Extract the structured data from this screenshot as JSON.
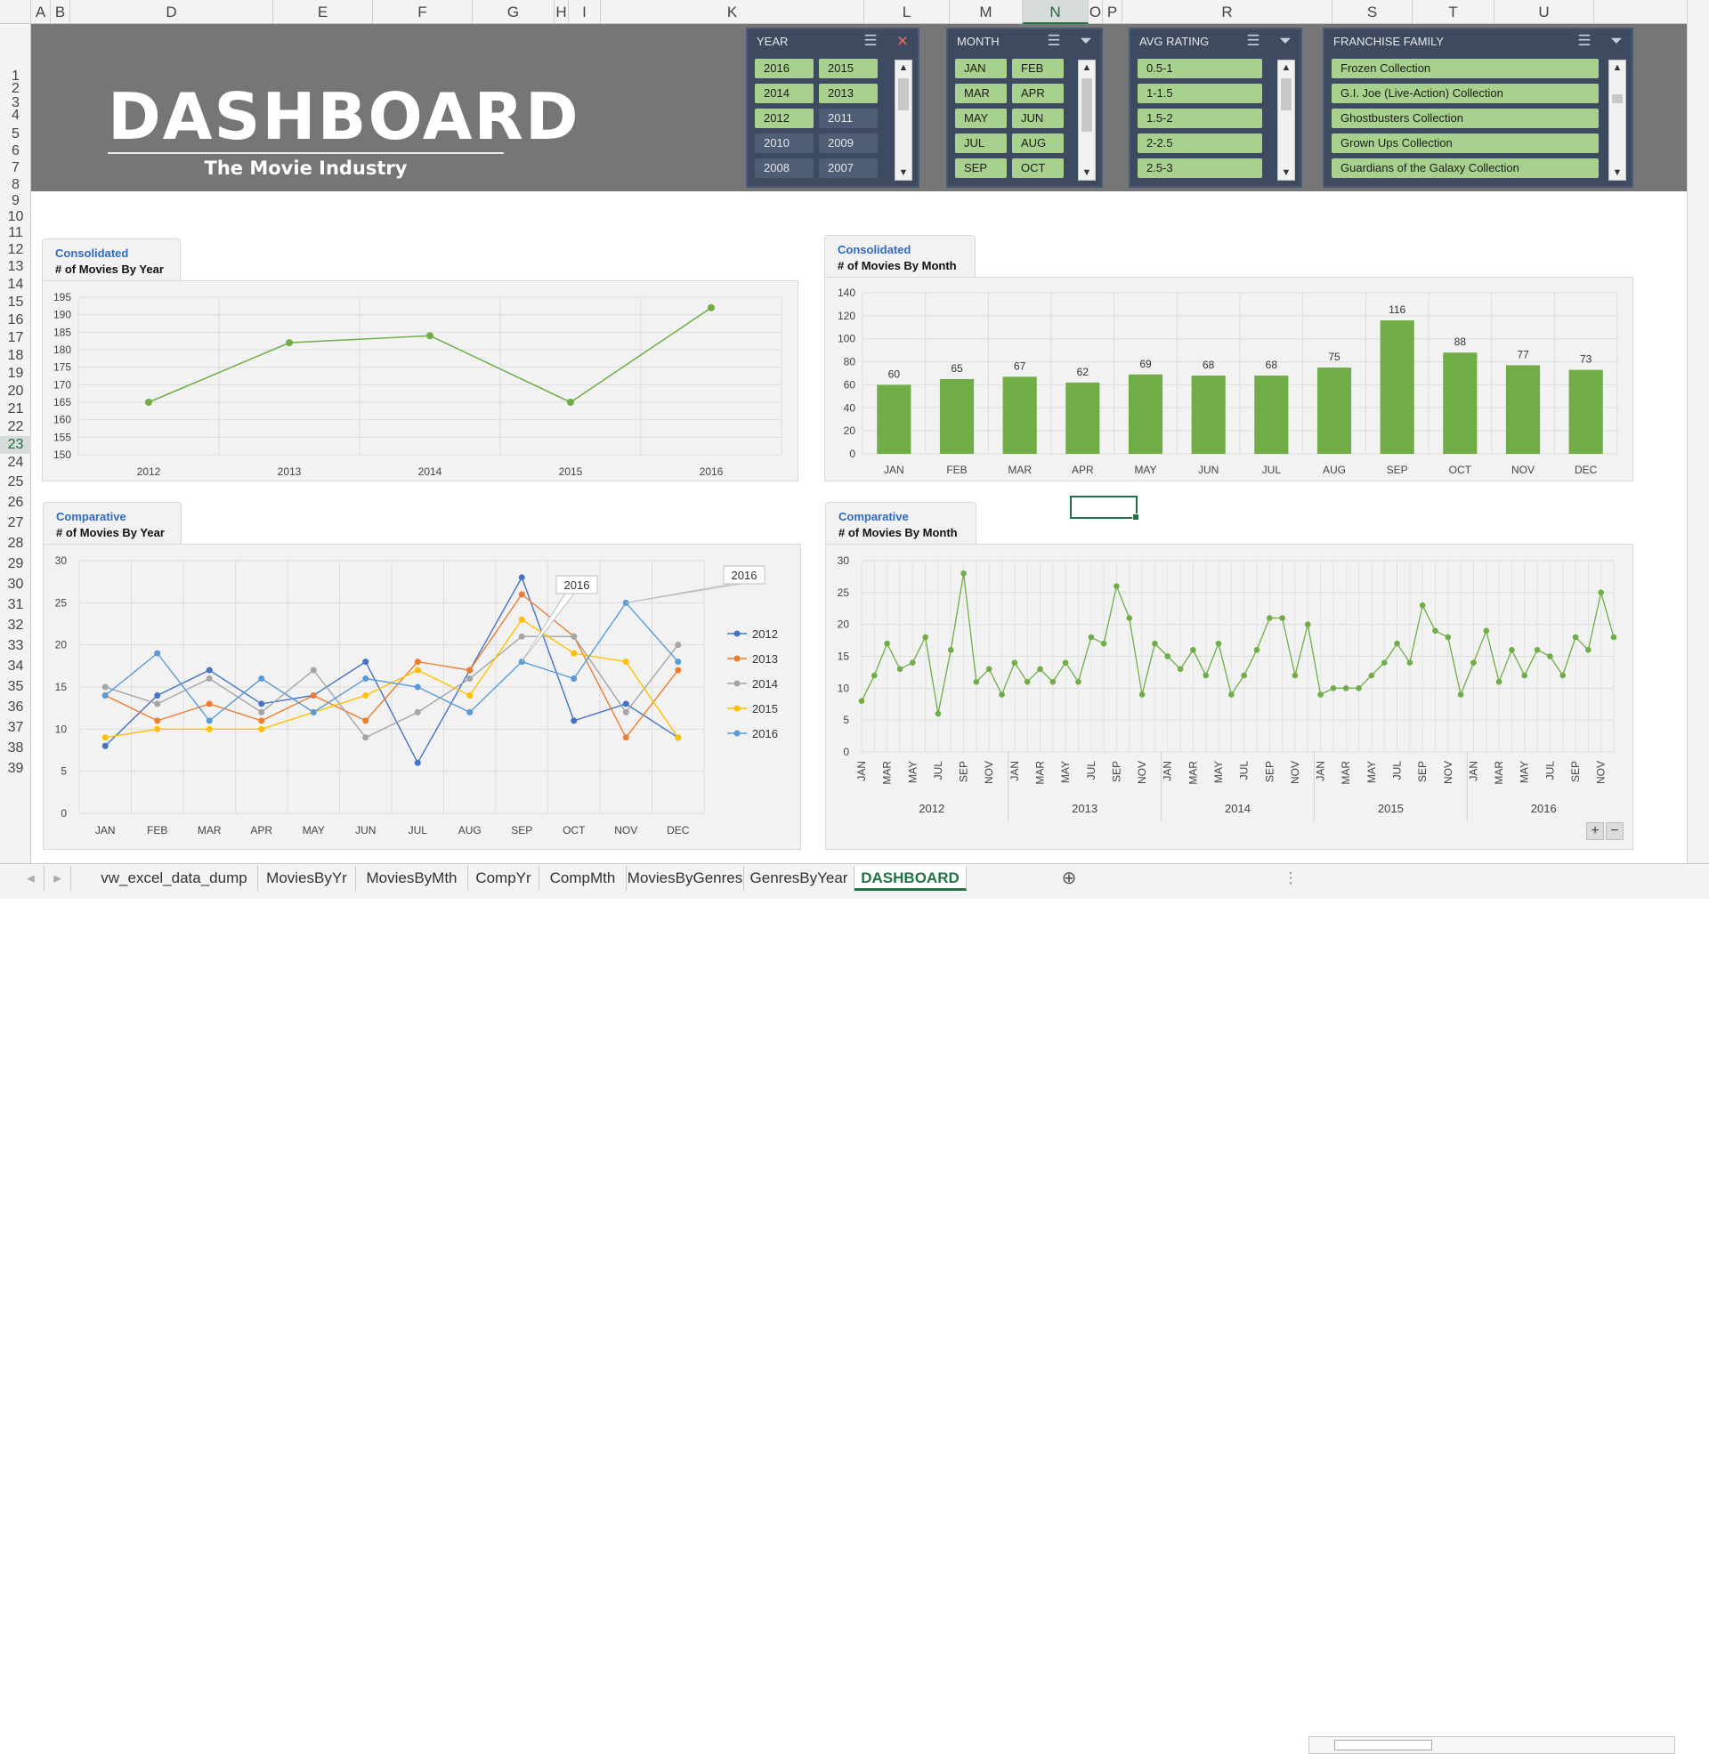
{
  "columns": [
    "A",
    "B",
    "D",
    "E",
    "F",
    "G",
    "H",
    "I",
    "K",
    "L",
    "M",
    "N",
    "O",
    "P",
    "R",
    "S",
    "T",
    "U"
  ],
  "selected_column": "N",
  "rows": [
    "1",
    "2",
    "3",
    "4",
    "5",
    "6",
    "7",
    "8",
    "9",
    "10",
    "11",
    "12",
    "13",
    "14",
    "15",
    "16",
    "17",
    "18",
    "19",
    "20",
    "21",
    "22",
    "23",
    "24",
    "25",
    "26",
    "27",
    "28",
    "29",
    "30",
    "31",
    "32",
    "33",
    "34",
    "35",
    "36",
    "37",
    "38",
    "39"
  ],
  "selected_row": "23",
  "banner": {
    "title": "DASHBOARD",
    "subtitle": "The Movie Industry"
  },
  "slicers": [
    {
      "title": "YEAR",
      "items": [
        "2016",
        "2015",
        "2014",
        "2013",
        "2012",
        "2011",
        "2010",
        "2009",
        "2008",
        "2007"
      ],
      "selected": [
        "2016",
        "2015",
        "2014",
        "2013",
        "2012"
      ],
      "cols": 2
    },
    {
      "title": "MONTH",
      "items": [
        "JAN",
        "FEB",
        "MAR",
        "APR",
        "MAY",
        "JUN",
        "JUL",
        "AUG",
        "SEP",
        "OCT"
      ],
      "selected": [
        "JAN",
        "FEB",
        "MAR",
        "APR",
        "MAY",
        "JUN",
        "JUL",
        "AUG",
        "SEP",
        "OCT"
      ],
      "cols": 2
    },
    {
      "title": "AVG RATING",
      "items": [
        "0.5-1",
        "1-1.5",
        "1.5-2",
        "2-2.5",
        "2.5-3"
      ],
      "selected": [
        "0.5-1",
        "1-1.5",
        "1.5-2",
        "2-2.5",
        "2.5-3"
      ],
      "cols": 1
    },
    {
      "title": "FRANCHISE FAMILY",
      "items": [
        "Frozen Collection",
        "G.I. Joe (Live-Action) Collection",
        "Ghostbusters Collection",
        "Grown Ups Collection",
        "Guardians of the Galaxy Collection"
      ],
      "selected": [
        "Frozen Collection",
        "G.I. Joe (Live-Action) Collection",
        "Ghostbusters Collection",
        "Grown Ups Collection",
        "Guardians of the Galaxy Collection"
      ],
      "cols": 1
    }
  ],
  "panels": {
    "p1": {
      "label1": "Consolidated",
      "label2": "# of Movies By Year"
    },
    "p2": {
      "label1": "Consolidated",
      "label2": "# of Movies By Month"
    },
    "p3": {
      "label1": "Comparative",
      "label2": "# of Movies By Year"
    },
    "p4": {
      "label1": "Comparative",
      "label2": "# of Movies By Month"
    }
  },
  "colors": {
    "green": "#70ad47",
    "c2012": "#4472c4",
    "c2013": "#ed7d31",
    "c2014": "#a5a5a5",
    "c2015": "#ffc000",
    "c2016": "#5b9bd5"
  },
  "chart_data": [
    {
      "type": "line",
      "title": "# of Movies By Year",
      "categories": [
        "2012",
        "2013",
        "2014",
        "2015",
        "2016"
      ],
      "values": [
        165,
        182,
        184,
        165,
        192
      ],
      "ylim": [
        150,
        195
      ],
      "yticks": [
        150,
        155,
        160,
        165,
        170,
        175,
        180,
        185,
        190,
        195
      ],
      "grid": true
    },
    {
      "type": "bar",
      "title": "# of Movies By Month",
      "categories": [
        "JAN",
        "FEB",
        "MAR",
        "APR",
        "MAY",
        "JUN",
        "JUL",
        "AUG",
        "SEP",
        "OCT",
        "NOV",
        "DEC"
      ],
      "values": [
        60,
        65,
        67,
        62,
        69,
        68,
        68,
        75,
        116,
        88,
        77,
        73
      ],
      "ylim": [
        0,
        140
      ],
      "yticks": [
        0,
        20,
        40,
        60,
        80,
        100,
        120,
        140
      ],
      "data_labels": true
    },
    {
      "type": "line",
      "title": "# of Movies By Year",
      "categories": [
        "JAN",
        "FEB",
        "MAR",
        "APR",
        "MAY",
        "JUN",
        "JUL",
        "AUG",
        "SEP",
        "OCT",
        "NOV",
        "DEC"
      ],
      "series": [
        {
          "name": "2012",
          "values": [
            8,
            14,
            17,
            13,
            14,
            18,
            6,
            17,
            28,
            11,
            13,
            9
          ]
        },
        {
          "name": "2013",
          "values": [
            14,
            11,
            13,
            11,
            14,
            11,
            18,
            17,
            26,
            21,
            9,
            17
          ]
        },
        {
          "name": "2014",
          "values": [
            15,
            13,
            16,
            12,
            17,
            9,
            12,
            16,
            21,
            21,
            12,
            20
          ]
        },
        {
          "name": "2015",
          "values": [
            9,
            10,
            10,
            10,
            12,
            14,
            17,
            14,
            23,
            19,
            18,
            9
          ]
        },
        {
          "name": "2016",
          "values": [
            14,
            19,
            11,
            16,
            12,
            16,
            15,
            12,
            18,
            16,
            25,
            18
          ]
        }
      ],
      "ylim": [
        0,
        30
      ],
      "yticks": [
        0,
        5,
        10,
        15,
        20,
        25,
        30
      ],
      "legend": "right",
      "callouts": [
        "2016",
        "2016"
      ]
    },
    {
      "type": "line",
      "title": "# of Movies By Month",
      "years": [
        "2012",
        "2013",
        "2014",
        "2015",
        "2016"
      ],
      "month_labels": [
        "JAN",
        "MAR",
        "MAY",
        "JUL",
        "SEP",
        "NOV"
      ],
      "values": [
        8,
        12,
        17,
        13,
        14,
        18,
        6,
        16,
        28,
        11,
        13,
        9,
        14,
        11,
        13,
        11,
        14,
        11,
        18,
        17,
        26,
        21,
        9,
        17,
        15,
        13,
        16,
        12,
        17,
        9,
        12,
        16,
        21,
        21,
        12,
        20,
        9,
        10,
        10,
        10,
        12,
        14,
        17,
        14,
        23,
        19,
        18,
        9,
        14,
        19,
        11,
        16,
        12,
        16,
        15,
        12,
        18,
        16,
        25,
        18
      ],
      "ylim": [
        0,
        30
      ],
      "yticks": [
        0,
        5,
        10,
        15,
        20,
        25,
        30
      ],
      "grid": true
    }
  ],
  "sheet_tabs": [
    "vw_excel_data_dump",
    "MoviesByYr",
    "MoviesByMth",
    "CompYr",
    "CompMth",
    "MoviesByGenres",
    "GenresByYear",
    "DASHBOARD"
  ],
  "active_sheet": "DASHBOARD"
}
